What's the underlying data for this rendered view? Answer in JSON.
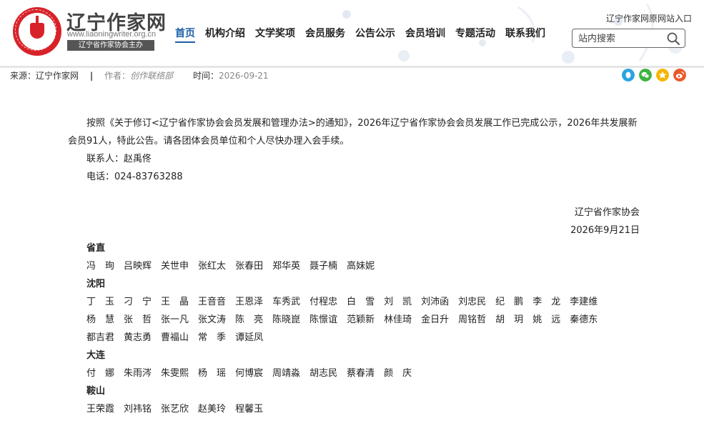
{
  "header": {
    "site_name": "辽宁作家网",
    "site_url": "www.liaoningwriter.org.cn",
    "sponsor_badge": "辽宁省作家协会主办",
    "old_site_link": "辽宁作家网原网站入口",
    "search_placeholder": "站内搜索"
  },
  "nav": [
    "首页",
    "机构介绍",
    "文学奖项",
    "会员服务",
    "公告公示",
    "会员培训",
    "专题活动",
    "联系我们"
  ],
  "meta": {
    "source_label": "来源：",
    "source": "辽宁作家网",
    "separator": "|",
    "author_label": "作者：",
    "author": "创作联络部",
    "time_label": "时间：",
    "time": "2026-09-21"
  },
  "share_icons": [
    {
      "name": "qq-share-icon",
      "color": "#2aa3e0"
    },
    {
      "name": "wechat-share-icon",
      "color": "#3fb33f"
    },
    {
      "name": "qzone-share-icon",
      "color": "#f5b400"
    },
    {
      "name": "weibo-share-icon",
      "color": "#e8592a"
    }
  ],
  "article": {
    "intro": "按照《关于修订<辽宁省作家协会会员发展和管理办法>的通知》，2026年辽宁省作家协会会员发展工作已完成公示，2026年共发展新会员91人，特此公告。请各团体会员单位和个人尽快办理入会手续。",
    "contact": "联系人：赵禹佟",
    "phone": "电话：024-83763288",
    "signature_org": "辽宁省作家协会",
    "signature_date": "2026年9月21日",
    "sections": [
      {
        "region": "省直",
        "names": [
          "冯　珣",
          "吕映辉",
          "关世申",
          "张红太",
          "张春田",
          "郑华英",
          "聂子楠",
          "高妹妮"
        ]
      },
      {
        "region": "沈阳",
        "names": [
          "丁　玉",
          "刁　宁",
          "王　晶",
          "王音音",
          "王恩泽",
          "车秀武",
          "付程忠",
          "白　雪",
          "刘　凯",
          "刘沛函",
          "刘忠民",
          "纪　鹏",
          "李　龙",
          "李建维",
          "杨　慧",
          "张　哲",
          "张一凡",
          "张文涛",
          "陈　亮",
          "陈晓崑",
          "陈憬谊",
          "范颖新",
          "林佳琦",
          "金日升",
          "周铭哲",
          "胡　玥",
          "姚　远",
          "秦德东",
          "都吉君",
          "黄志勇",
          "曹福山",
          "常　季",
          "谭延凤"
        ]
      },
      {
        "region": "大连",
        "names": [
          "付　娜",
          "朱雨涔",
          "朱雯熙",
          "杨　瑶",
          "何博宸",
          "周靖淼",
          "胡志民",
          "蔡春清",
          "颜　庆"
        ]
      },
      {
        "region": "鞍山",
        "names": [
          "王荣霞",
          "刘祎铭",
          "张艺欣",
          "赵美玲",
          "程馨玉"
        ]
      }
    ]
  },
  "colors": {
    "accent": "#1a5fa8",
    "logo_red": "#d8222a"
  }
}
